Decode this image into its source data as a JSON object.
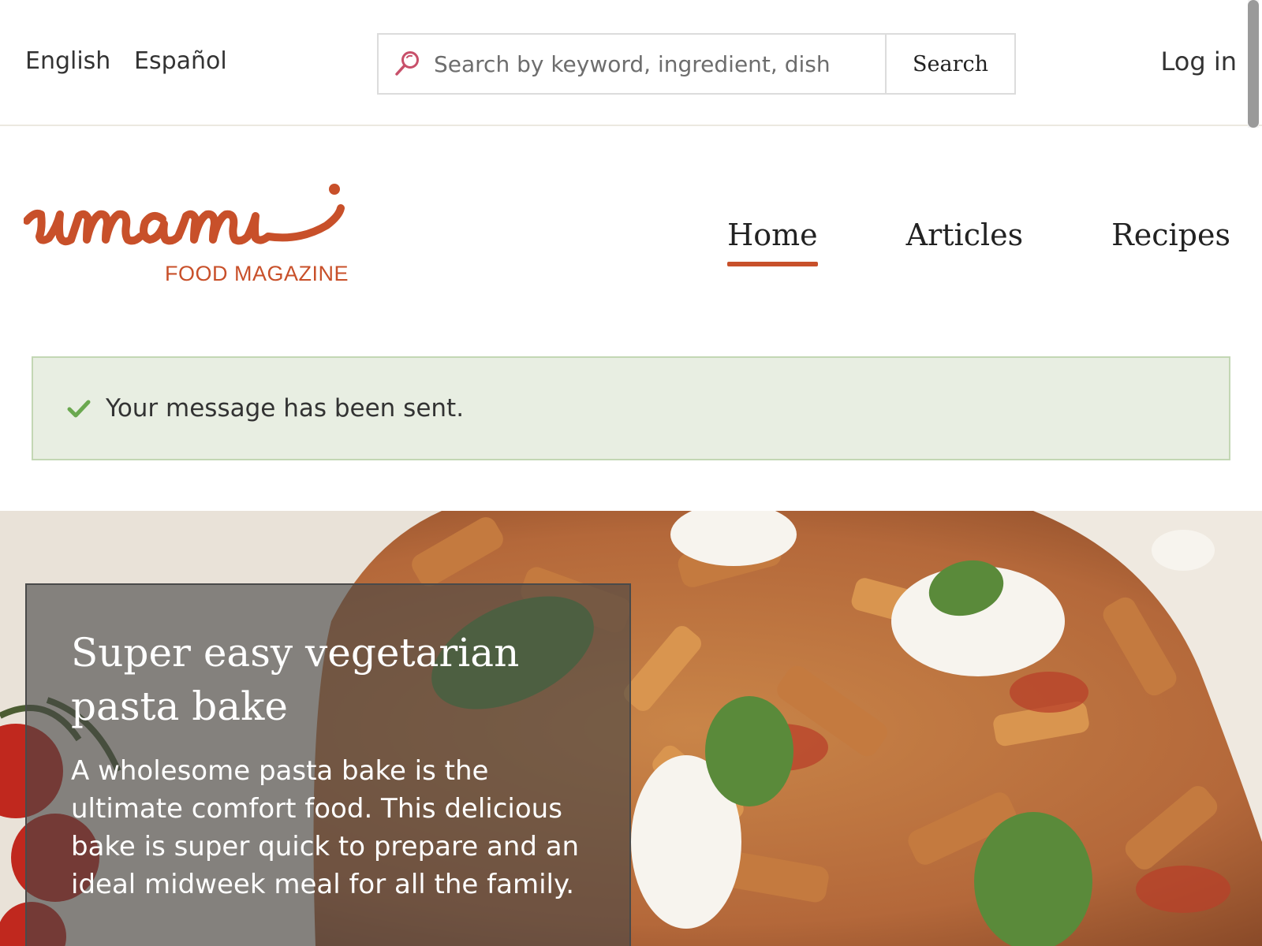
{
  "topbar": {
    "languages": [
      "English",
      "Español"
    ],
    "search": {
      "placeholder": "Search by keyword, ingredient, dish",
      "button_label": "Search"
    },
    "login_label": "Log in"
  },
  "brand": {
    "name": "umami",
    "tagline": "FOOD MAGAZINE",
    "color": "#c8502a"
  },
  "nav": {
    "items": [
      {
        "label": "Home",
        "active": true
      },
      {
        "label": "Articles",
        "active": false
      },
      {
        "label": "Recipes",
        "active": false
      }
    ]
  },
  "status_message": {
    "text": "Your message has been sent.",
    "icon": "check-icon",
    "color": "#6aa84f"
  },
  "hero": {
    "title": "Super easy vegetarian pasta bake",
    "description": "A wholesome pasta bake is the ultimate comfort food. This delicious bake is super quick to prepare and an ideal midweek meal for all the family."
  }
}
